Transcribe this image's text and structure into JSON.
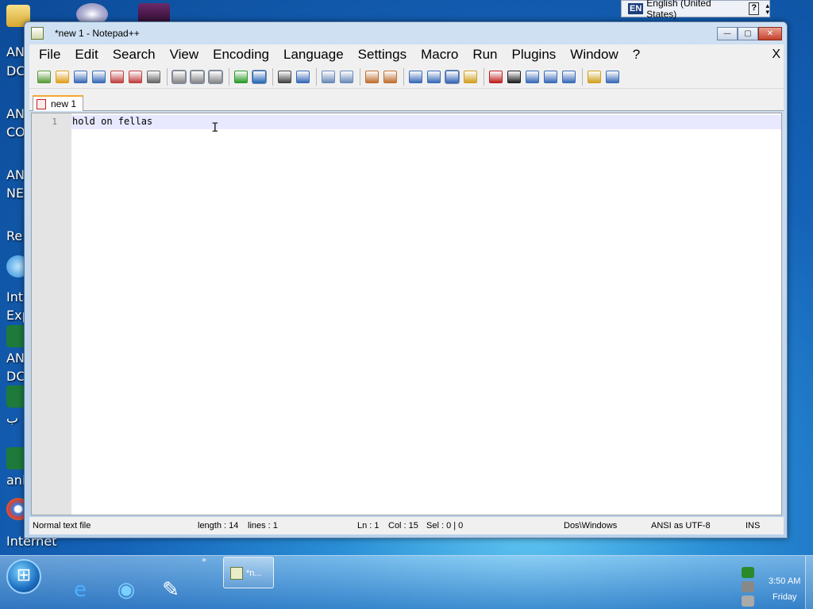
{
  "desktop": {
    "labels": [
      "AN",
      "DC",
      "AN",
      "CO",
      "AN",
      "NE",
      "Re",
      "Inte",
      "Exp",
      "AN",
      "DC",
      "ب",
      "ani",
      "Internet"
    ]
  },
  "langbar": {
    "badge": "EN",
    "language": "English (United States)",
    "help": "?"
  },
  "window": {
    "title": "*new  1 - Notepad++",
    "minimize": "—",
    "maximize": "▢",
    "close": "✕"
  },
  "menu": {
    "items": [
      "File",
      "Edit",
      "Search",
      "View",
      "Encoding",
      "Language",
      "Settings",
      "Macro",
      "Run",
      "Plugins",
      "Window",
      "?"
    ],
    "close": "X"
  },
  "tab": {
    "label": "new  1"
  },
  "editor": {
    "line_number": "1",
    "text": "hold on fellas",
    "caret": "I"
  },
  "status": {
    "file_type": "Normal text file",
    "length": "length : 14",
    "lines": "lines : 1",
    "ln": "Ln : 1",
    "col": "Col : 15",
    "sel": "Sel : 0 | 0",
    "eol": "Dos\\Windows",
    "encoding": "ANSI as UTF-8",
    "mode": "INS"
  },
  "taskbar": {
    "start": "⊞",
    "task_label": "*n...",
    "time": "3:50 AM",
    "day": "Friday",
    "chevron": "»"
  },
  "colors": {
    "toolbar_icons": [
      "#5a9a3a",
      "#e0a020",
      "#3a6ab8",
      "#3a6ab8",
      "#c04040",
      "#c04040",
      "#666666",
      "#888888",
      "#888888",
      "#888888",
      "#2a9a2a",
      "#2a6ab8",
      "#444444",
      "#3a6ab8",
      "#6a8ab8",
      "#6a8ab8",
      "#c07030",
      "#c07030",
      "#3a6ab8",
      "#3a6ab8",
      "#3a6ab8",
      "#d0a020",
      "#c02020",
      "#202020",
      "#3a6ab8",
      "#3a6ab8",
      "#3a6ab8",
      "#d0a020",
      "#3a6ab8"
    ]
  }
}
